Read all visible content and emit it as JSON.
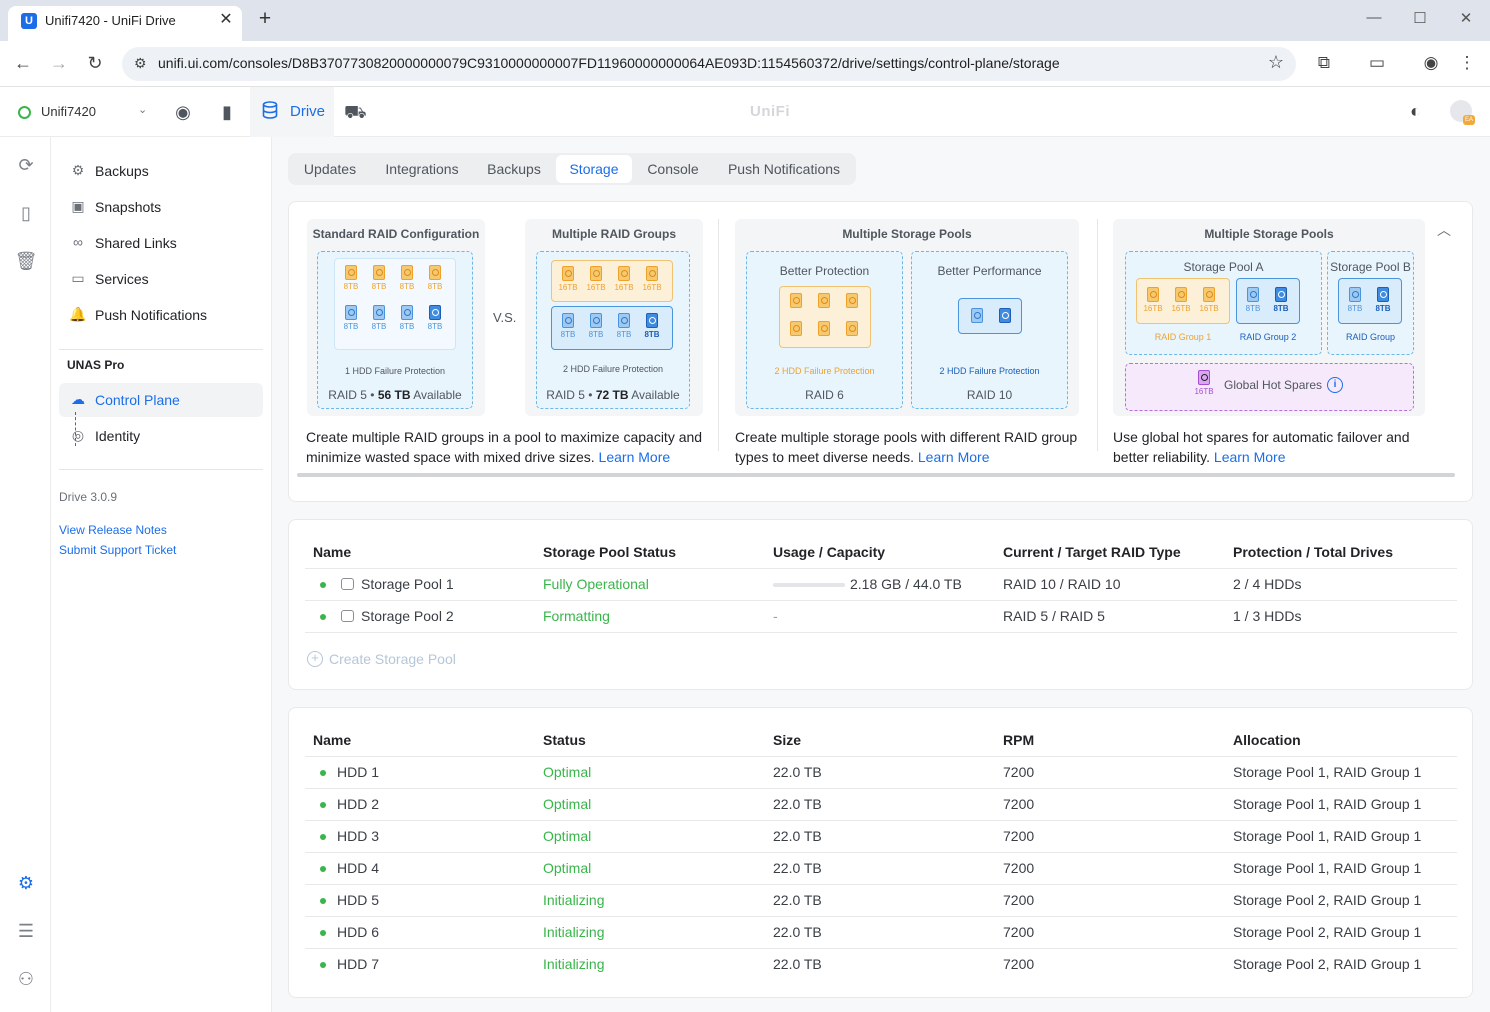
{
  "browser": {
    "tab_title": "Unifi7420 - UniFi Drive",
    "favicon": "U",
    "url": "unifi.ui.com/consoles/D8B3707730820000000079C9310000000007FD11960000000064AE093D:1154560372/drive/settings/control-plane/storage"
  },
  "header": {
    "console_name": "Unifi7420",
    "app_label": "Drive",
    "brand": "UniFi",
    "avatar_badge": "EA"
  },
  "sidebar": {
    "items": [
      {
        "label": "Backups",
        "icon": "backups-icon"
      },
      {
        "label": "Snapshots",
        "icon": "snapshot-icon"
      },
      {
        "label": "Shared Links",
        "icon": "link-icon"
      },
      {
        "label": "Services",
        "icon": "monitor-icon"
      },
      {
        "label": "Push Notifications",
        "icon": "bell-icon"
      }
    ],
    "section_title": "UNAS Pro",
    "section_items": [
      {
        "label": "Control Plane",
        "icon": "control-plane-icon",
        "active": true
      },
      {
        "label": "Identity",
        "icon": "fingerprint-icon"
      }
    ],
    "version": "Drive 3.0.9",
    "links": [
      "View Release Notes",
      "Submit Support Ticket"
    ]
  },
  "tabs": [
    "Updates",
    "Integrations",
    "Backups",
    "Storage",
    "Console",
    "Push Notifications"
  ],
  "active_tab": "Storage",
  "info": {
    "panel1": {
      "title": "Standard RAID Configuration",
      "sizes": [
        "8TB",
        "8TB",
        "8TB",
        "8TB",
        "8TB",
        "8TB",
        "8TB",
        "8TB"
      ],
      "caption": "1 HDD Failure Protection",
      "raid_prefix": "RAID 5 •",
      "raid_value": "56 TB",
      "raid_suffix": "Available"
    },
    "vs": "V.S.",
    "panel2": {
      "title": "Multiple RAID Groups",
      "sizes_top": [
        "16TB",
        "16TB",
        "16TB",
        "16TB"
      ],
      "sizes_bottom": [
        "8TB",
        "8TB",
        "8TB",
        "8TB"
      ],
      "caption": "2 HDD Failure Protection",
      "raid_prefix": "RAID 5 •",
      "raid_value": "72 TB",
      "raid_suffix": "Available"
    },
    "desc1": "Create multiple RAID groups in a pool to maximize capacity and minimize wasted space with mixed drive sizes.",
    "learn_more": "Learn More",
    "panel3": {
      "title": "Multiple Storage Pools",
      "left_title": "Better Protection",
      "left_caption": "2 HDD Failure Protection",
      "left_raid": "RAID 6",
      "right_title": "Better Performance",
      "right_caption": "2 HDD Failure Protection",
      "right_raid": "RAID 10"
    },
    "desc2": "Create multiple storage pools with different RAID group types to meet diverse needs.",
    "panel4": {
      "title": "Multiple Storage Pools",
      "pool_a": "Storage Pool A",
      "pool_b": "Storage Pool B",
      "group1_sizes": [
        "16TB",
        "16TB",
        "16TB"
      ],
      "group1": "RAID Group 1",
      "group2_sizes": [
        "8TB",
        "8TB"
      ],
      "group2": "RAID Group 2",
      "poolb_sizes": [
        "8TB",
        "8TB"
      ],
      "poolb_group": "RAID Group",
      "spare_size": "16TB",
      "spare_label": "Global Hot Spares"
    },
    "desc3": "Use global hot spares for automatic failover and better reliability."
  },
  "pools_table": {
    "headers": [
      "Name",
      "Storage Pool Status",
      "Usage / Capacity",
      "Current / Target RAID Type",
      "Protection / Total Drives"
    ],
    "rows": [
      {
        "name": "Storage Pool 1",
        "status": "Fully Operational",
        "usage": "2.18 GB / 44.0 TB",
        "usage_fraction": 0.0,
        "raid": "RAID 10 / RAID 10",
        "protection": "2 / 4 HDDs"
      },
      {
        "name": "Storage Pool 2",
        "status": "Formatting",
        "usage": "-",
        "raid": "RAID 5 / RAID 5",
        "protection": "1 / 3 HDDs"
      }
    ],
    "create_label": "Create Storage Pool"
  },
  "drives_table": {
    "headers": [
      "Name",
      "Status",
      "Size",
      "RPM",
      "Allocation"
    ],
    "rows": [
      {
        "name": "HDD 1",
        "status": "Optimal",
        "size": "22.0 TB",
        "rpm": "7200",
        "allocation": "Storage Pool 1, RAID Group 1"
      },
      {
        "name": "HDD 2",
        "status": "Optimal",
        "size": "22.0 TB",
        "rpm": "7200",
        "allocation": "Storage Pool 1, RAID Group 1"
      },
      {
        "name": "HDD 3",
        "status": "Optimal",
        "size": "22.0 TB",
        "rpm": "7200",
        "allocation": "Storage Pool 1, RAID Group 1"
      },
      {
        "name": "HDD 4",
        "status": "Optimal",
        "size": "22.0 TB",
        "rpm": "7200",
        "allocation": "Storage Pool 1, RAID Group 1"
      },
      {
        "name": "HDD 5",
        "status": "Initializing",
        "size": "22.0 TB",
        "rpm": "7200",
        "allocation": "Storage Pool 2, RAID Group 1"
      },
      {
        "name": "HDD 6",
        "status": "Initializing",
        "size": "22.0 TB",
        "rpm": "7200",
        "allocation": "Storage Pool 2, RAID Group 1"
      },
      {
        "name": "HDD 7",
        "status": "Initializing",
        "size": "22.0 TB",
        "rpm": "7200",
        "allocation": "Storage Pool 2, RAID Group 1"
      }
    ]
  },
  "colors": {
    "accent": "#1b6ee8",
    "status_green": "#39b54a",
    "drive_orange": "#eea12b",
    "drive_blue": "#4b94dc",
    "spare_purple": "#a44fd1"
  }
}
